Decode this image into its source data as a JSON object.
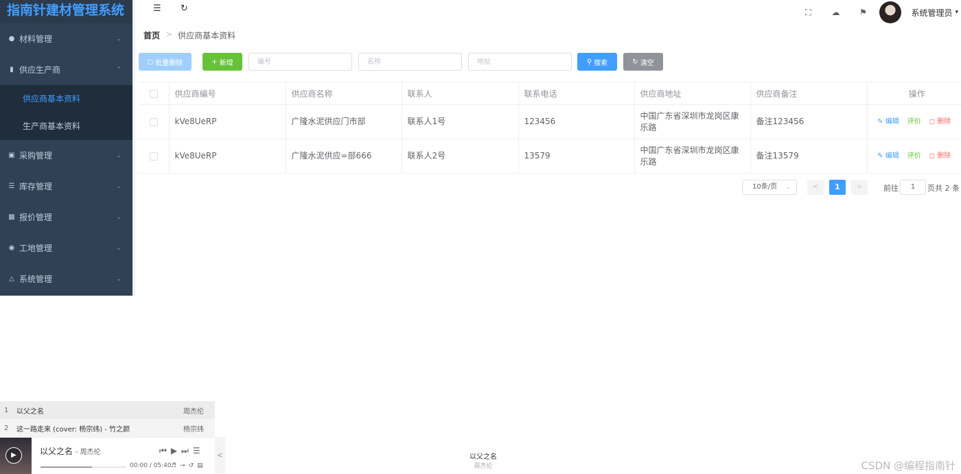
{
  "app": {
    "title": "指南针建材管理系统"
  },
  "sidebar": {
    "items": [
      {
        "icon": "drop-icon",
        "label": "材料管理",
        "expanded": false
      },
      {
        "icon": "document-icon",
        "label": "供应生产商",
        "expanded": true,
        "children": [
          {
            "label": "供应商基本资料",
            "active": true
          },
          {
            "label": "生产商基本资料",
            "active": false
          }
        ]
      },
      {
        "icon": "cart-icon",
        "label": "采购管理",
        "expanded": false
      },
      {
        "icon": "database-icon",
        "label": "库存管理",
        "expanded": false
      },
      {
        "icon": "money-icon",
        "label": "报价管理",
        "expanded": false
      },
      {
        "icon": "location-icon",
        "label": "工地管理",
        "expanded": false
      },
      {
        "icon": "flask-icon",
        "label": "系统管理",
        "expanded": false
      }
    ]
  },
  "header": {
    "user_name": "系统管理员"
  },
  "breadcrumb": {
    "home": "首页",
    "current": "供应商基本资料"
  },
  "toolbar": {
    "batch_delete": "批量删除",
    "add": "新增",
    "code_placeholder": "编号",
    "name_placeholder": "名称",
    "address_placeholder": "地址",
    "search": "搜索",
    "clear": "清空"
  },
  "table": {
    "columns": [
      "供应商编号",
      "供应商名称",
      "联系人",
      "联系电话",
      "供应商地址",
      "供应商备注",
      "操作"
    ],
    "rows": [
      {
        "code": "kVe8UeRP",
        "name": "广隆水泥供应门市部",
        "contact": "联系人1号",
        "phone": "123456",
        "address": "中国广东省深圳市龙岗区康乐路",
        "remark": "备注123456"
      },
      {
        "code": "kVe8UeRP",
        "name": "广隆水泥供应=部666",
        "contact": "联系人2号",
        "phone": "13579",
        "address": "中国广东省深圳市龙岗区康乐路",
        "remark": "备注13579"
      }
    ],
    "actions": {
      "edit": "编辑",
      "rate": "评价",
      "delete": "删除"
    }
  },
  "pagination": {
    "page_size": "10条/页",
    "current_page": "1",
    "goto_label": "前往",
    "goto_value": "1",
    "total_text": "页共 2 条"
  },
  "music_player": {
    "playlist": [
      {
        "index": "1",
        "title": "以父之名",
        "artist": "周杰伦"
      },
      {
        "index": "2",
        "title": "这一路走来 (cover: 杨宗纬) - 竹之颜",
        "artist": "杨宗纬"
      }
    ],
    "now_playing": {
      "title": "以父之名",
      "artist": "周杰伦",
      "time": "00:00 / 05:40",
      "progress": 0.6
    },
    "lyric": {
      "line1": "以父之名",
      "line2": "周杰伦"
    }
  },
  "watermark": "CSDN @编程指南针",
  "colors": {
    "primary": "#409eff",
    "success": "#67c23a",
    "danger": "#f56c6c",
    "sidebar_bg": "#304156",
    "info": "#909399"
  }
}
